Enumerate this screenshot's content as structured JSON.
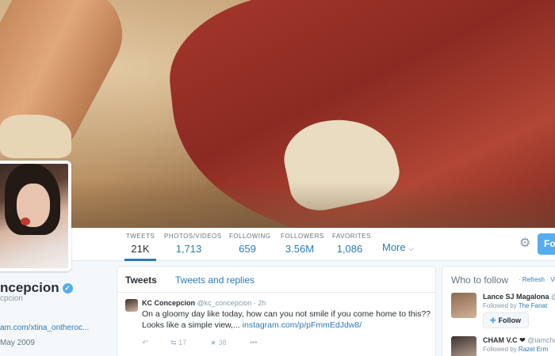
{
  "header": {
    "photo_alt": "header-photo"
  },
  "nav": {
    "stats": [
      {
        "label": "TWEETS",
        "value": "21K"
      },
      {
        "label": "PHOTOS/VIDEOS",
        "value": "1,713"
      },
      {
        "label": "FOLLOWING",
        "value": "659"
      },
      {
        "label": "FOLLOWERS",
        "value": "3.56M"
      },
      {
        "label": "FAVORITES",
        "value": "1,086"
      }
    ],
    "more_label": "More",
    "follow_label": "Fo"
  },
  "profile": {
    "name": "ncepcion",
    "handle": "cpcion",
    "link": "am.com/xtina_ontheroc...",
    "joined": "May 2009"
  },
  "timeline": {
    "tabs": [
      "Tweets",
      "Tweets and replies"
    ],
    "tweet": {
      "name": "KC Concepcion",
      "handle": "@kc_concepcion",
      "time": "· 2h",
      "text": "On a gloomy day like today, how can you not smile if you come home to this?? Looks like a simple view,...",
      "link": "instagram.com/p/pFmmEdJdw8/",
      "retweets": "17",
      "favorites": "38"
    }
  },
  "who_to_follow": {
    "title": "Who to follow",
    "refresh": "Refresh",
    "view": "Vi",
    "suggestions": [
      {
        "name": "Lance SJ Magalona",
        "handle": "@l",
        "followed_by_prefix": "Followed by",
        "followed_by": "The Fanat",
        "button": "Follow"
      },
      {
        "name": "CHAM V.C ❤",
        "handle": "@iamcha",
        "followed_by_prefix": "Followed by",
        "followed_by": "Razel Erm"
      }
    ]
  },
  "colors": {
    "accent": "#2b7bb9",
    "follow_button": "#55acee"
  }
}
